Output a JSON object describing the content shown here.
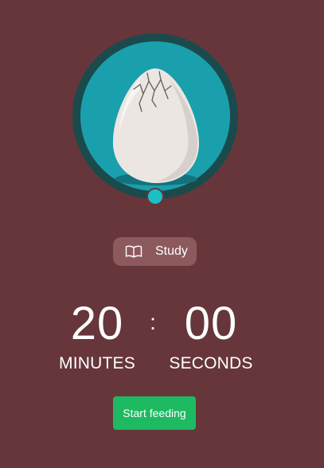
{
  "colors": {
    "background": "#66363a",
    "ring_outer": "#1a4a4c",
    "ring_inner": "#1a9fac",
    "progress_knob": "#1cbfc4",
    "tag_background": "#8c5a5d",
    "button_background": "#1dba62"
  },
  "egg": {
    "icon": "cracked-egg-icon",
    "progress_percent": 0
  },
  "tag": {
    "icon": "book-icon",
    "label": "Study"
  },
  "timer": {
    "minutes": "20",
    "separator": ":",
    "seconds": "00",
    "minutes_label": "MINUTES",
    "seconds_label": "SECONDS"
  },
  "actions": {
    "start_label": "Start feeding"
  }
}
